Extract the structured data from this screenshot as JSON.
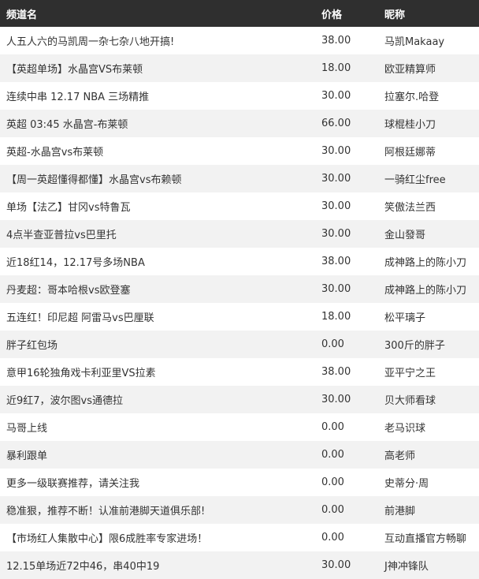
{
  "headers": {
    "channel": "频道名",
    "price": "价格",
    "nickname": "昵称"
  },
  "rows": [
    {
      "channel": "人五人六的马凯周一杂七杂八地开搞!",
      "price": "38.00",
      "nickname": "马凯Makaay"
    },
    {
      "channel": "【英超单场】水晶宫VS布莱顿",
      "price": "18.00",
      "nickname": "欧亚精算师"
    },
    {
      "channel": "连续中串 12.17 NBA 三场精推",
      "price": "30.00",
      "nickname": "拉塞尔.哈登"
    },
    {
      "channel": "英超 03:45 水晶宫-布莱顿",
      "price": "66.00",
      "nickname": "球棍桂小刀"
    },
    {
      "channel": "英超-水晶宫vs布莱顿",
      "price": "30.00",
      "nickname": "阿根廷娜蒂"
    },
    {
      "channel": "【周一英超懂得都懂】水晶宫vs布赖顿",
      "price": "30.00",
      "nickname": "一骑红尘free"
    },
    {
      "channel": "单场【法乙】甘冈vs特鲁瓦",
      "price": "30.00",
      "nickname": "笑傲法兰西"
    },
    {
      "channel": "4点半查亚普拉vs巴里托",
      "price": "30.00",
      "nickname": "金山發哥"
    },
    {
      "channel": "近18红14，12.17号多场NBA",
      "price": "38.00",
      "nickname": "成神路上的陈小刀"
    },
    {
      "channel": "丹麦超：哥本哈根vs欧登塞",
      "price": "30.00",
      "nickname": "成神路上的陈小刀"
    },
    {
      "channel": "五连红！印尼超 阿雷马vs巴厘联",
      "price": "18.00",
      "nickname": "松平璃子"
    },
    {
      "channel": "胖子红包场",
      "price": "0.00",
      "nickname": "300斤的胖子"
    },
    {
      "channel": "意甲16轮独角戏卡利亚里VS拉素",
      "price": "38.00",
      "nickname": "亚平宁之王"
    },
    {
      "channel": "近9红7，波尔图vs通德拉",
      "price": "30.00",
      "nickname": "贝大师看球"
    },
    {
      "channel": "马哥上线",
      "price": "0.00",
      "nickname": "老马识球"
    },
    {
      "channel": "暴利跟单",
      "price": "0.00",
      "nickname": "高老师"
    },
    {
      "channel": "更多一级联赛推荐，请关注我",
      "price": "0.00",
      "nickname": "史蒂分·周"
    },
    {
      "channel": "稳准狠，推荐不断！认准前港脚天道俱乐部!",
      "price": "0.00",
      "nickname": "前港脚"
    },
    {
      "channel": "【市场红人集散中心】限6成胜率专家进场！",
      "price": "0.00",
      "nickname": "互动直播官方畅聊"
    },
    {
      "channel": "12.15单场近72中46，串40中19",
      "price": "30.00",
      "nickname": "J神冲锋队"
    }
  ]
}
